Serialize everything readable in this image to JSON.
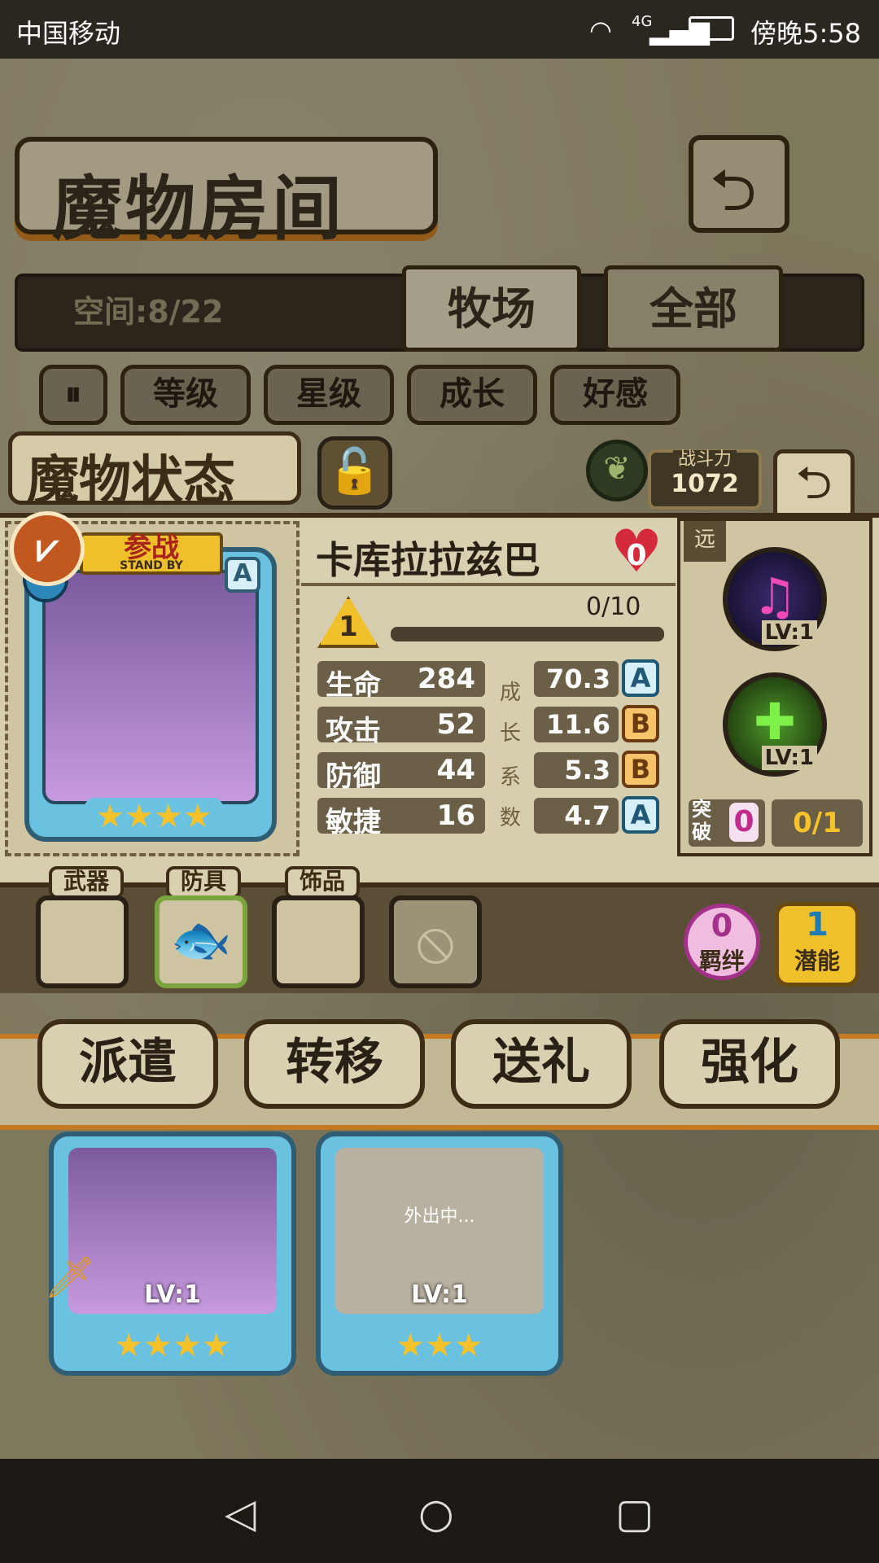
{
  "status_bar": {
    "carrier": "中国移动",
    "network": "4G",
    "time": "傍晚5:58"
  },
  "header": {
    "title": "魔物房间",
    "back_icon": "return-arrow-icon"
  },
  "tabs": {
    "space_label": "空间:8/22",
    "items": [
      "牧场",
      "全部"
    ],
    "active": "牧场"
  },
  "filters": [
    "等级",
    "星级",
    "成长",
    "好感"
  ],
  "status_panel": {
    "title": "魔物状态",
    "power_label": "战斗力",
    "power_value": "1072",
    "monster": {
      "name": "卡库拉拉兹巴",
      "hearts": "0",
      "standby_label": "参战",
      "standby_sub": "STAND BY",
      "rank": "A",
      "stars": 4,
      "level": "1",
      "exp": "0/10",
      "exp_fraction": 0.0
    },
    "stats": [
      {
        "label": "生命",
        "value": "284",
        "coef": "70.3",
        "grade": "A"
      },
      {
        "label": "攻击",
        "value": "52",
        "coef": "11.6",
        "grade": "B"
      },
      {
        "label": "防御",
        "value": "44",
        "coef": "5.3",
        "grade": "B"
      },
      {
        "label": "敏捷",
        "value": "16",
        "coef": "4.7",
        "grade": "A"
      }
    ],
    "growth_label": [
      "成",
      "长",
      "系",
      "数"
    ],
    "range_label": "远",
    "skills": [
      {
        "icon": "music-note-icon",
        "level": "LV:1"
      },
      {
        "icon": "heal-cross-icon",
        "level": "LV:1"
      }
    ],
    "breakthrough": {
      "label": "突破",
      "value": "0",
      "progress": "0/1"
    }
  },
  "equipment": {
    "slots": [
      {
        "label": "武器"
      },
      {
        "label": "防具"
      },
      {
        "label": "饰品"
      }
    ],
    "bond": {
      "value": "0",
      "label": "羁绊"
    },
    "potential": {
      "value": "1",
      "label": "潜能"
    }
  },
  "actions": [
    "派遣",
    "转移",
    "送礼",
    "强化"
  ],
  "list_cards": [
    {
      "level": "LV:1",
      "stars": 4,
      "out": ""
    },
    {
      "level": "LV:1",
      "stars": 3,
      "out": "外出中..."
    }
  ]
}
